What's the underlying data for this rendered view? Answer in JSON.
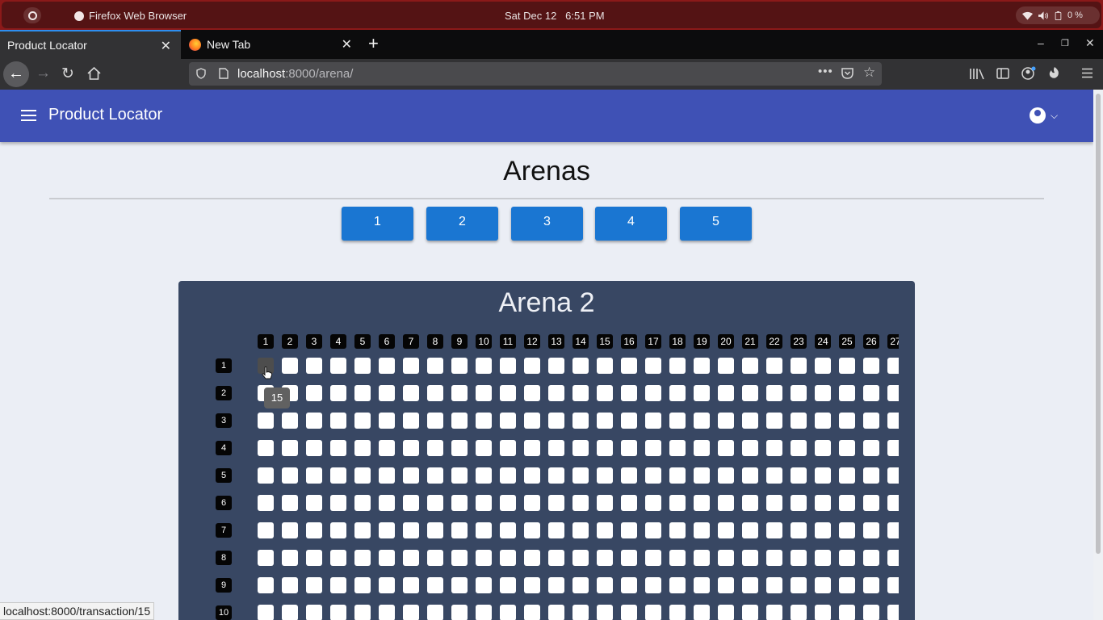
{
  "os": {
    "app_name": "Firefox Web Browser",
    "clock": "Sat Dec 12   6:51 PM",
    "battery": "0 %"
  },
  "browser": {
    "tabs": [
      {
        "label": "Product Locator",
        "active": true
      },
      {
        "label": "New Tab",
        "active": false
      }
    ],
    "url_host": "localhost",
    "url_rest": ":8000/arena/",
    "status_url": "localhost:8000/transaction/15"
  },
  "app": {
    "title": "Product Locator",
    "page_title": "Arenas",
    "arena_buttons": [
      "1",
      "2",
      "3",
      "4",
      "5"
    ],
    "arena": {
      "name": "Arena 2",
      "column_labels": [
        "1",
        "2",
        "3",
        "4",
        "5",
        "6",
        "7",
        "8",
        "9",
        "10",
        "11",
        "12",
        "13",
        "14",
        "15",
        "16",
        "17",
        "18",
        "19",
        "20",
        "21",
        "22",
        "23",
        "24",
        "25",
        "26",
        "27"
      ],
      "row_labels": [
        "1",
        "2",
        "3",
        "4",
        "5",
        "6",
        "7",
        "8",
        "9",
        "10"
      ],
      "tooltip": "15"
    }
  },
  "colors": {
    "appbar": "#3f51b5",
    "button": "#1a76d2",
    "panel": "#384763",
    "os_bar": "#8b1919"
  }
}
